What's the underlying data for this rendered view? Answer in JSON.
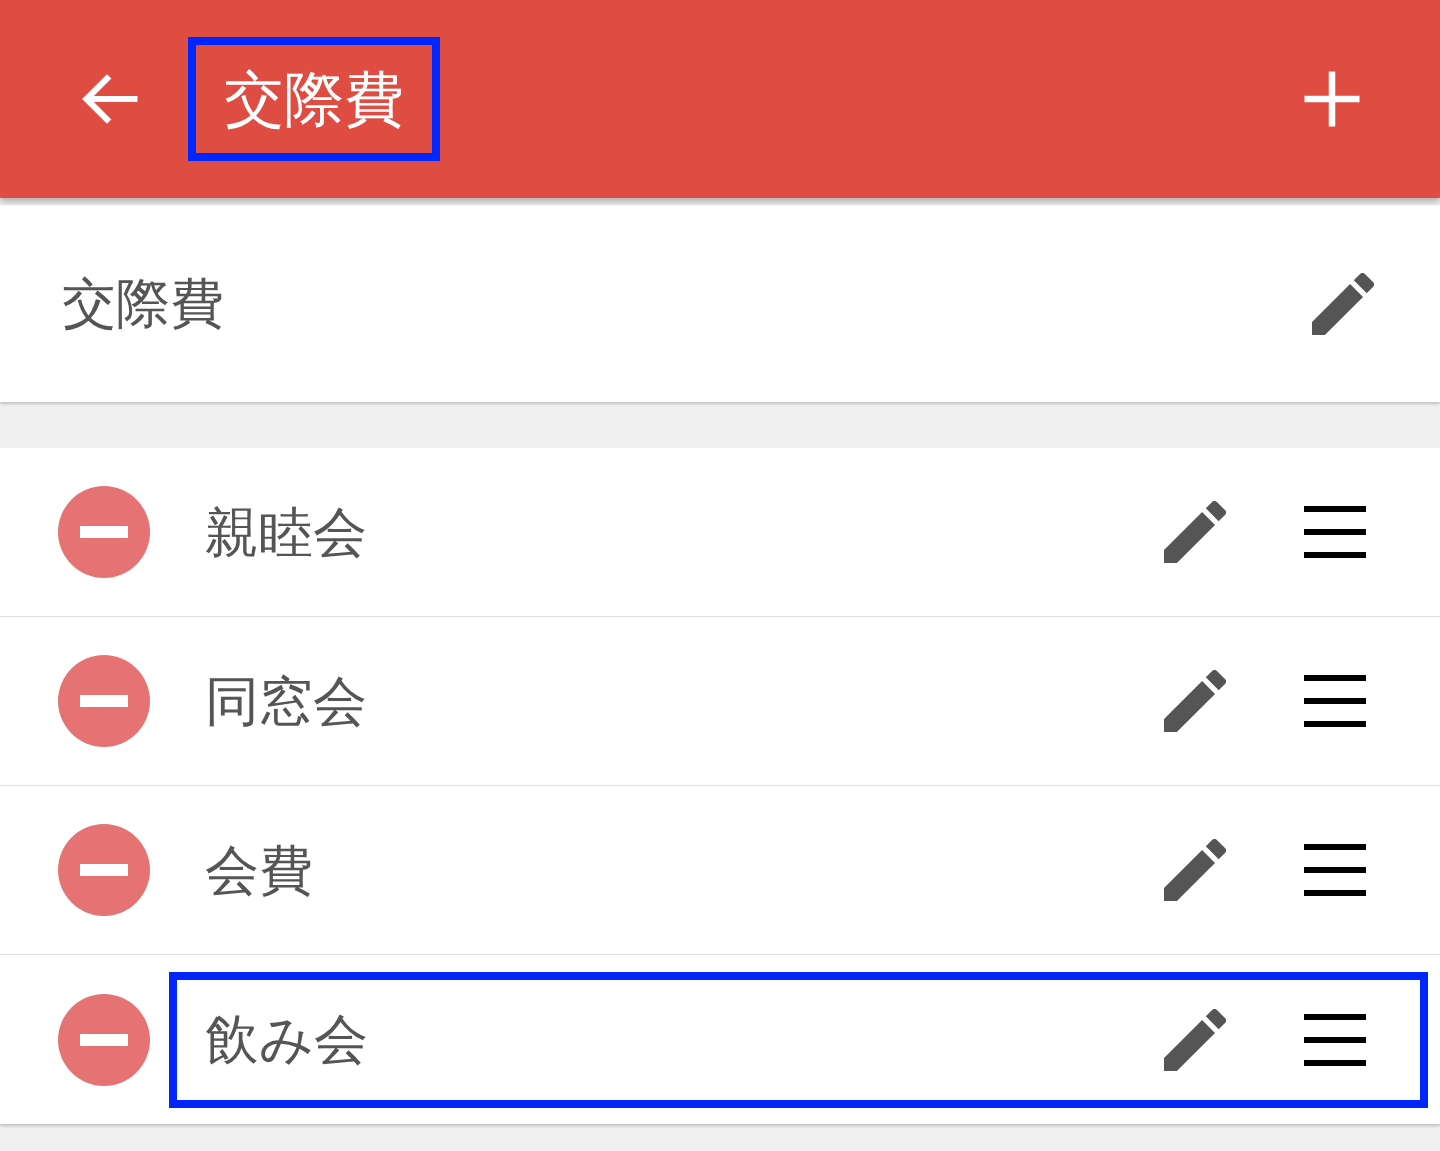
{
  "app_bar": {
    "title": "交際費",
    "highlighted": true
  },
  "category": {
    "name": "交際費"
  },
  "items": [
    {
      "name": "親睦会",
      "highlighted": false
    },
    {
      "name": "同窓会",
      "highlighted": false
    },
    {
      "name": "会費",
      "highlighted": false
    },
    {
      "name": "飲み会",
      "highlighted": true
    }
  ]
}
